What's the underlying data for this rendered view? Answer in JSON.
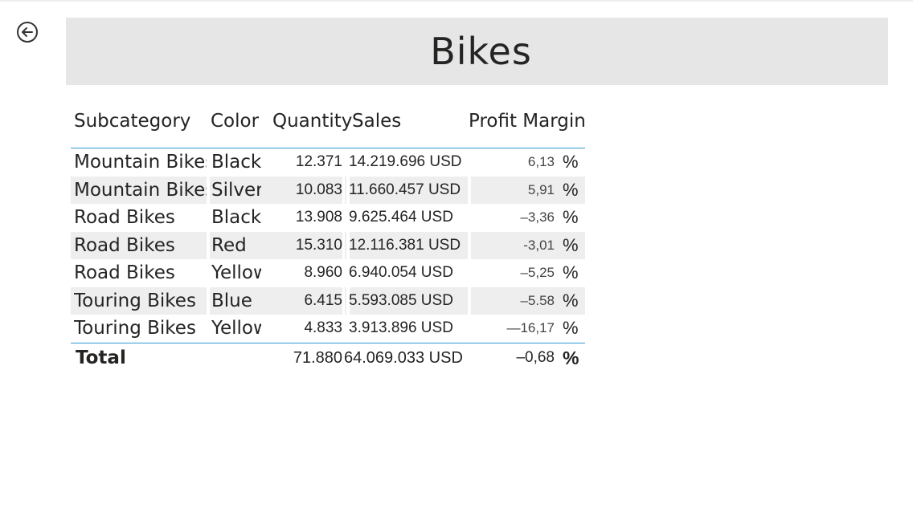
{
  "page": {
    "back_icon": "arrow-left-circle-icon",
    "title": "Bikes"
  },
  "table": {
    "headers": [
      "Subcategory",
      "Color",
      "Quantity",
      "Sales",
      "Profit Margin"
    ],
    "rows": [
      {
        "subcategory": "Mountain Bikes",
        "color": "Black",
        "quantity": "12.371",
        "sales": "14.219.696 USD",
        "profit_margin": "6,13",
        "pct": "%"
      },
      {
        "subcategory": "Mountain Bikes",
        "color": "Silver",
        "quantity": "10.083",
        "sales": "11.660.457 USD",
        "profit_margin": "5,91",
        "pct": "%"
      },
      {
        "subcategory": "Road Bikes",
        "color": "Black",
        "quantity": "13.908",
        "sales": "9.625.464 USD",
        "profit_margin": "–3,36",
        "pct": "%"
      },
      {
        "subcategory": "Road Bikes",
        "color": "Red",
        "quantity": "15.310",
        "sales": "12.116.381 USD",
        "profit_margin": "-3,01",
        "pct": "%"
      },
      {
        "subcategory": "Road Bikes",
        "color": "Yellow",
        "quantity": "8.960",
        "sales": "6.940.054 USD",
        "profit_margin": "–5,25",
        "pct": "%"
      },
      {
        "subcategory": "Touring Bikes",
        "color": "Blue",
        "quantity": "6.415",
        "sales": "5.593.085 USD",
        "profit_margin": "–5.58",
        "pct": "%"
      },
      {
        "subcategory": "Touring Bikes",
        "color": "Yellow",
        "quantity": "4.833",
        "sales": "3.913.896 USD",
        "profit_margin": "—16,17",
        "pct": "%"
      }
    ],
    "total": {
      "label": "Total",
      "quantity": "71.880",
      "sales": "64.069.033 USD",
      "profit_margin": "–0,68",
      "pct": "%"
    },
    "colors": {
      "divider": "#2b9bd4",
      "banded_row": "#eeeeee",
      "title_bar": "#e6e6e6"
    }
  }
}
